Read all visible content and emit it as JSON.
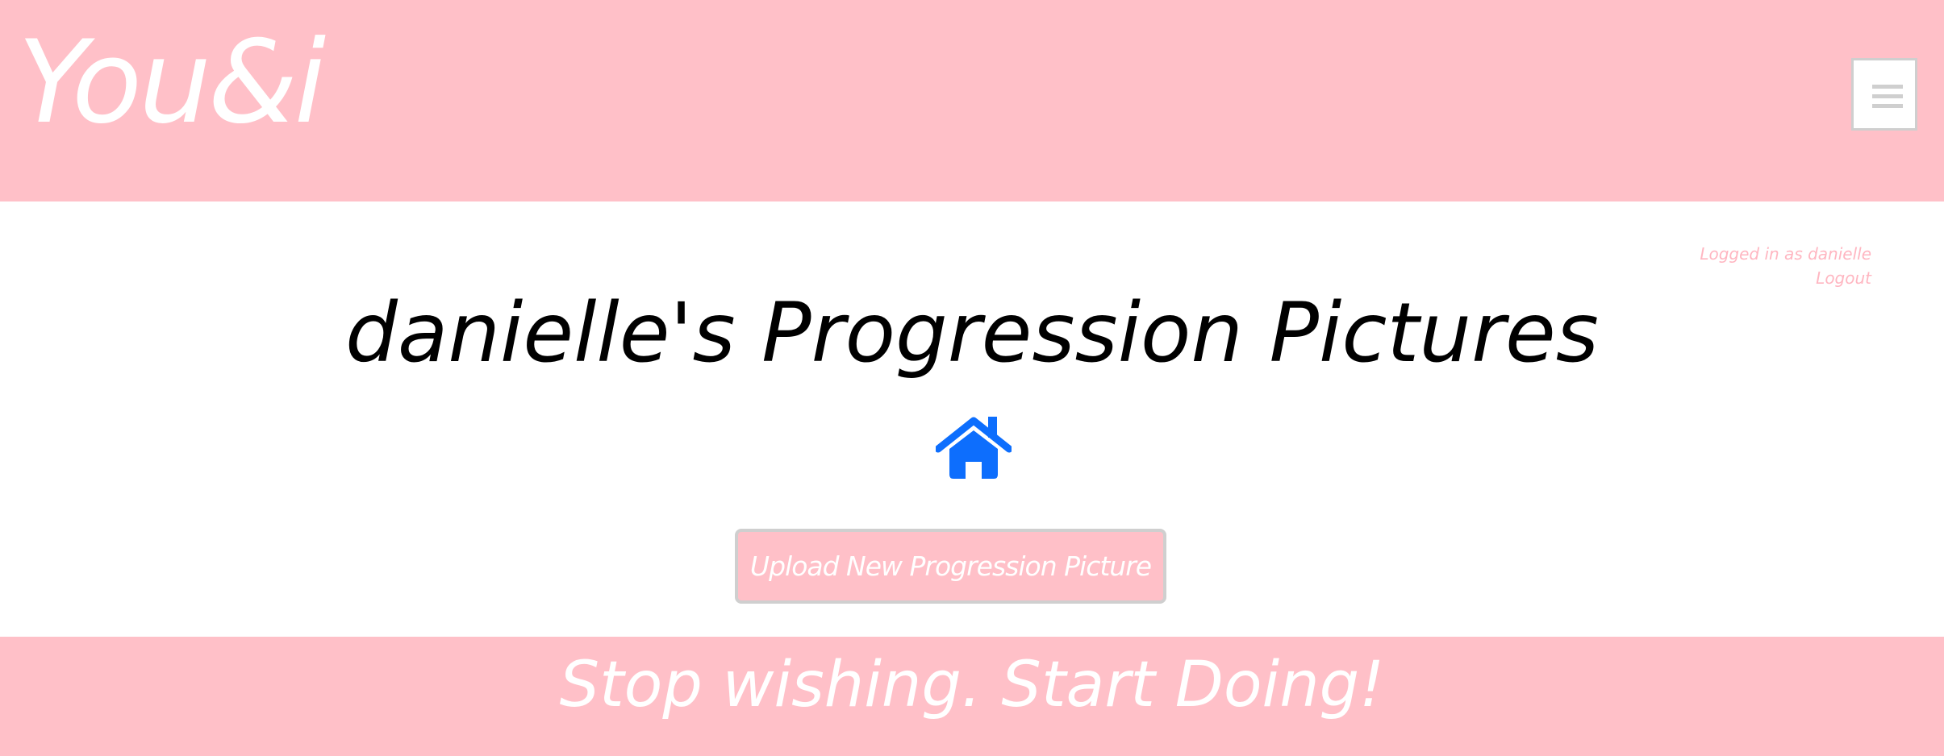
{
  "header": {
    "logo_text": "You&i",
    "menu_icon": "hamburger-menu-icon",
    "background_color": "#ffc0c8"
  },
  "session": {
    "logged_in_text": "Logged in as danielle",
    "logout_label": "Logout",
    "text_color": "#ffb6c1"
  },
  "main": {
    "title": "danielle's Progression Pictures",
    "home_icon": "home-icon",
    "home_icon_color": "#0d6efd",
    "upload_button_label": "Upload New Progression Picture"
  },
  "footer": {
    "tagline": "Stop wishing. Start Doing!"
  }
}
